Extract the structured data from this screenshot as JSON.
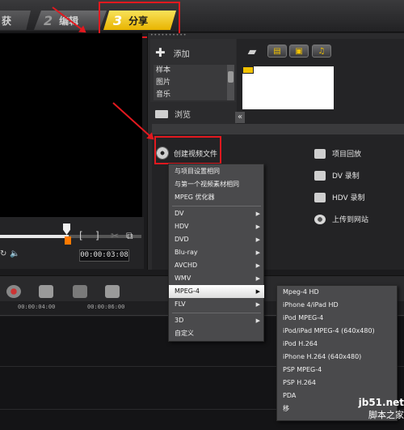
{
  "tabs": [
    {
      "num": "",
      "label": "获"
    },
    {
      "num": "2",
      "label": "编辑"
    },
    {
      "num": "3",
      "label": "分享"
    }
  ],
  "preview": {
    "timecode": "00:00:03:08",
    "bracket_in": "[",
    "bracket_out": "]"
  },
  "library": {
    "add_label": "添加",
    "items": [
      "样本",
      "图片",
      "音乐"
    ],
    "browse_label": "浏览"
  },
  "share": {
    "create_video_label": "创建视频文件",
    "options": [
      "项目回放",
      "DV 录制",
      "HDV 录制",
      "上传到网站"
    ]
  },
  "timeline": {
    "ticks": [
      "00:00:04:00",
      "00:00:06:00"
    ]
  },
  "menu_main": [
    {
      "label": "与项目设置相同",
      "submenu": false
    },
    {
      "label": "与第一个视频素材相同",
      "submenu": false
    },
    {
      "label": "MPEG 优化器",
      "submenu": false
    },
    {
      "label": "DV",
      "submenu": true
    },
    {
      "label": "HDV",
      "submenu": true
    },
    {
      "label": "DVD",
      "submenu": true
    },
    {
      "label": "Blu-ray",
      "submenu": true
    },
    {
      "label": "AVCHD",
      "submenu": true
    },
    {
      "label": "WMV",
      "submenu": true
    },
    {
      "label": "MPEG-4",
      "submenu": true
    },
    {
      "label": "FLV",
      "submenu": true
    },
    {
      "label": "3D",
      "submenu": true
    },
    {
      "label": "自定义",
      "submenu": false
    }
  ],
  "menu_mpeg4": [
    "Mpeg-4 HD",
    "iPhone 4/iPad HD",
    "iPod MPEG-4",
    "iPod/iPad MPEG-4 (640x480)",
    "iPod H.264",
    "iPhone H.264 (640x480)",
    "PSP MPEG-4",
    "PSP H.264",
    "PDA",
    "移"
  ],
  "watermark": {
    "top": "jb51.net",
    "bottom": "脚本之家"
  }
}
